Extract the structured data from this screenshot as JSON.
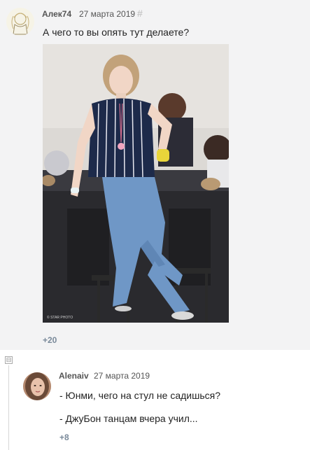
{
  "comments": [
    {
      "author": "Алек74",
      "date": "27 марта 2019",
      "anchor": "#",
      "text": "А чего то вы опять тут делаете?",
      "score": "+20"
    },
    {
      "collapse_symbol": "⊟",
      "author": "Alenaiv",
      "date": "27 марта 2019",
      "lines": [
        "- Юнми, чего на стул не садишься?",
        "- ДжуБон танцам вчера учил..."
      ],
      "score": "+8"
    }
  ],
  "colors": {
    "background_top": "#f3f3f4",
    "score": "#7a8a9a",
    "shirt": "#1d2a4a",
    "jeans": "#6f97c6"
  }
}
